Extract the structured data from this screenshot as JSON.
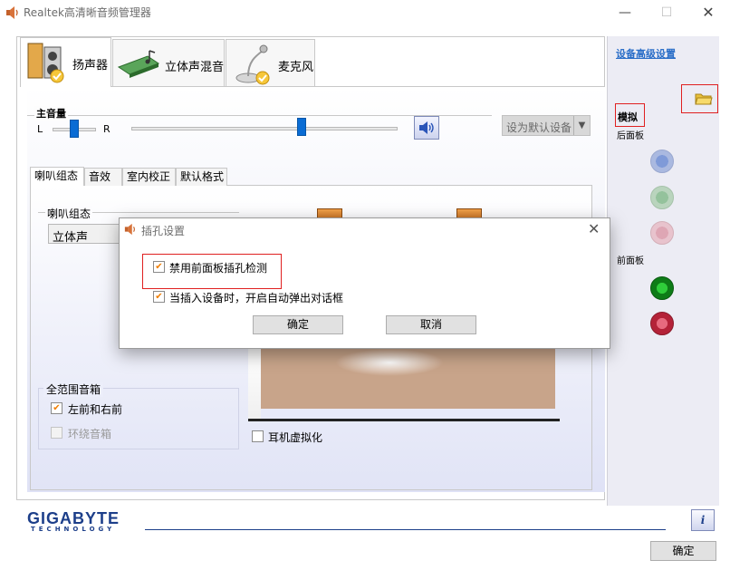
{
  "window": {
    "title": "Realtek高清晰音频管理器",
    "minimize": "—",
    "maximize": "☐",
    "close": "✕"
  },
  "tabs": [
    {
      "label": "扬声器",
      "icon": "speaker-icon"
    },
    {
      "label": "立体声混音",
      "icon": "mixer-card-icon"
    },
    {
      "label": "麦克风",
      "icon": "microphone-icon"
    }
  ],
  "volume": {
    "label": "主音量",
    "left": "L",
    "right": "R",
    "balance_level": 0.45,
    "volume_level": 0.64
  },
  "default_device_button": {
    "label": "设为默认设备",
    "arrow": "▼"
  },
  "subtabs": [
    "喇叭组态",
    "音效",
    "室内校正",
    "默认格式"
  ],
  "speaker_config": {
    "label": "喇叭组态",
    "selected": "立体声"
  },
  "fullrange": {
    "label": "全范围音箱",
    "front": {
      "label": "左前和右前",
      "checked": true
    },
    "surround": {
      "label": "环绕音箱",
      "checked": false,
      "disabled": true
    }
  },
  "headphone_virtualization": {
    "label": "耳机虚拟化",
    "checked": false
  },
  "right_panel": {
    "advanced_link": "设备高级设置",
    "analog": "模拟",
    "rear": "后面板",
    "front": "前面板"
  },
  "footer": {
    "brand": "GIGABYTE",
    "brand_sub": "TECHNOLOGY",
    "info": "i",
    "ok": "确定"
  },
  "dialog": {
    "title": "插孔设置",
    "close": "✕",
    "disable_front_detect": {
      "label": "禁用前面板插孔检测",
      "checked": true
    },
    "auto_popup": {
      "label": "当插入设备时，开启自动弹出对话框",
      "checked": true
    },
    "ok": "确定",
    "cancel": "取消"
  },
  "check_mark": "✔",
  "colors": {
    "accent": "#0a6cd4",
    "highlight": "#e02020",
    "brand": "#1d3f8a"
  }
}
